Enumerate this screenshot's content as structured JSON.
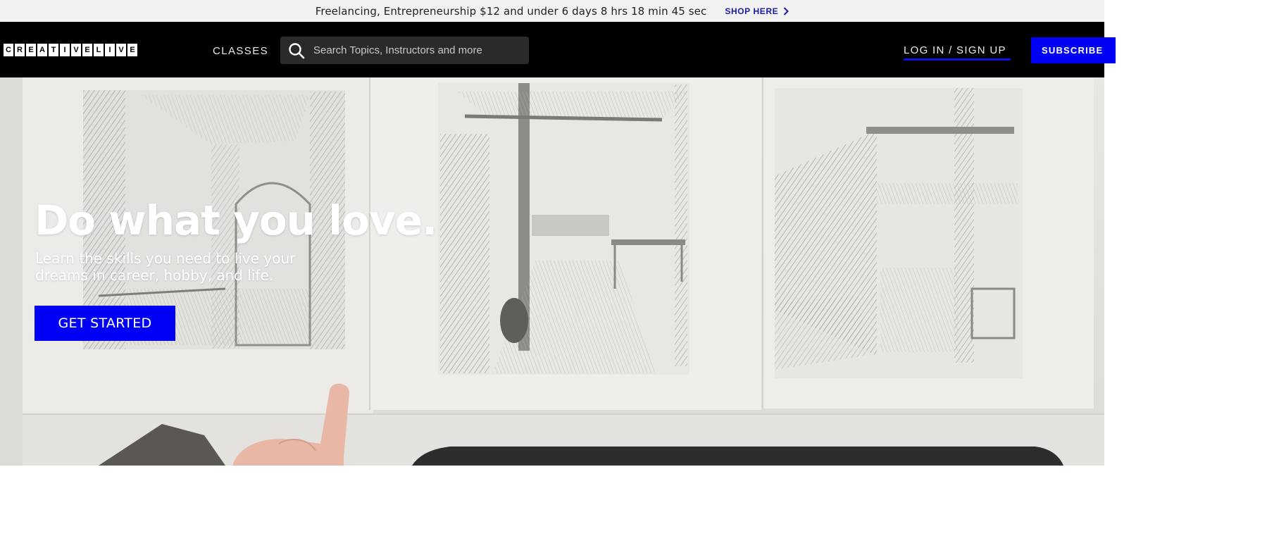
{
  "promo": {
    "text": "Freelancing, Entrepreneurship $12 and under 6 days 8 hrs 18 min 45 sec",
    "link_label": "SHOP HERE",
    "link_icon": "chevron-right-icon"
  },
  "header": {
    "logo_letters": [
      "C",
      "R",
      "E",
      "A",
      "T",
      "I",
      "V",
      "E",
      "L",
      "I",
      "V",
      "E"
    ],
    "nav_classes": "CLASSES",
    "search": {
      "placeholder": "Search Topics, Instructors and more",
      "icon": "search-icon"
    },
    "login_label": "LOG IN / SIGN UP",
    "subscribe_label": "SUBSCRIBE"
  },
  "hero": {
    "title": "Do what you love.",
    "subtitle": "Learn the skills you need to live your dreams in career, hobby, and life.",
    "cta_label": "GET STARTED"
  },
  "colors": {
    "accent_blue": "#0000f5",
    "header_bg": "#000000",
    "promo_bg": "#f2f2f2",
    "promo_link": "#1a1aa6"
  }
}
